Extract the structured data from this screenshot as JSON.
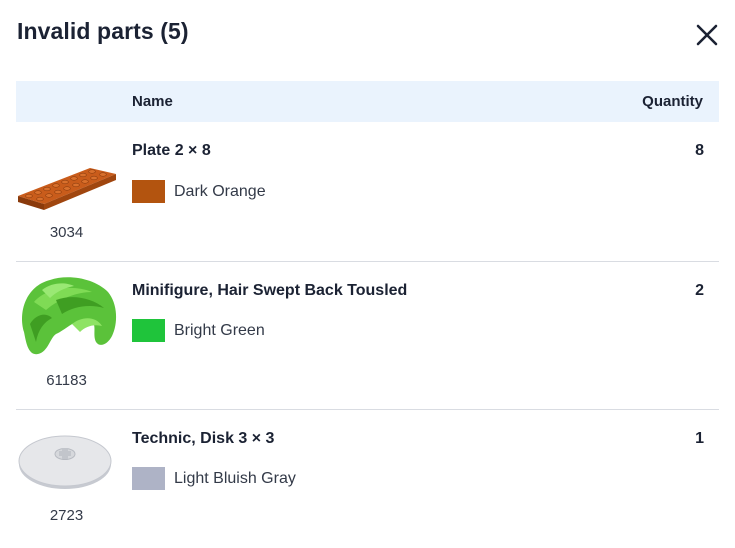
{
  "dialog": {
    "title": "Invalid parts (5)",
    "close_icon": "close-icon"
  },
  "table": {
    "columns": {
      "name": "Name",
      "quantity": "Quantity"
    },
    "rows": [
      {
        "part_number": "3034",
        "name": "Plate 2 × 8",
        "color_name": "Dark Orange",
        "color_hex": "#b3540f",
        "quantity": "8",
        "image": "plate-2x8-image"
      },
      {
        "part_number": "61183",
        "name": "Minifigure, Hair Swept Back Tousled",
        "color_name": "Bright Green",
        "color_hex": "#1fc43b",
        "quantity": "2",
        "image": "hair-swept-back-image"
      },
      {
        "part_number": "2723",
        "name": "Technic, Disk 3 × 3",
        "color_name": "Light Bluish Gray",
        "color_hex": "#aeb3c6",
        "quantity": "1",
        "image": "technic-disk-image"
      }
    ]
  }
}
